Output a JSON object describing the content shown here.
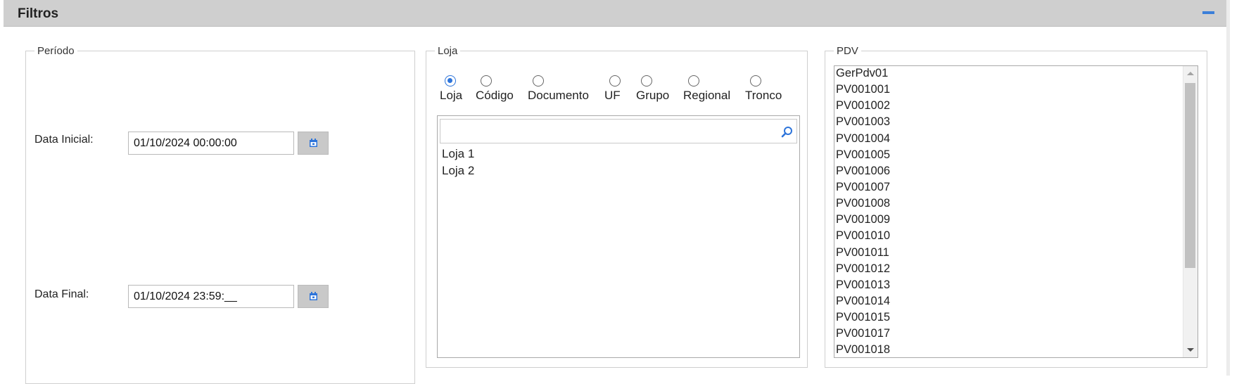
{
  "header": {
    "title": "Filtros",
    "collapse_icon": "minus-icon"
  },
  "periodo": {
    "legend": "Período",
    "data_inicial_label": "Data Inicial:",
    "data_inicial_value": "01/10/2024 00:00:00",
    "data_final_label": "Data Final:",
    "data_final_value": "01/10/2024 23:59:__",
    "calendar_icon": "calendar-icon"
  },
  "loja": {
    "legend": "Loja",
    "radio_options": [
      {
        "label": "Loja",
        "checked": true
      },
      {
        "label": "Código",
        "checked": false
      },
      {
        "label": "Documento",
        "checked": false
      },
      {
        "label": "UF",
        "checked": false
      },
      {
        "label": "Grupo",
        "checked": false
      },
      {
        "label": "Regional",
        "checked": false
      },
      {
        "label": "Tronco",
        "checked": false
      }
    ],
    "search_value": "",
    "items": [
      "Loja 1",
      "Loja 2"
    ]
  },
  "pdv": {
    "legend": "PDV",
    "items": [
      "GerPdv01",
      "PV001001",
      "PV001002",
      "PV001003",
      "PV001004",
      "PV001005",
      "PV001006",
      "PV001007",
      "PV001008",
      "PV001009",
      "PV001010",
      "PV001011",
      "PV001012",
      "PV001013",
      "PV001014",
      "PV001015",
      "PV001017",
      "PV001018"
    ]
  },
  "colors": {
    "accent": "#2d74da",
    "header_bg": "#cfcfcf",
    "button_bg": "#c9c9c9"
  }
}
